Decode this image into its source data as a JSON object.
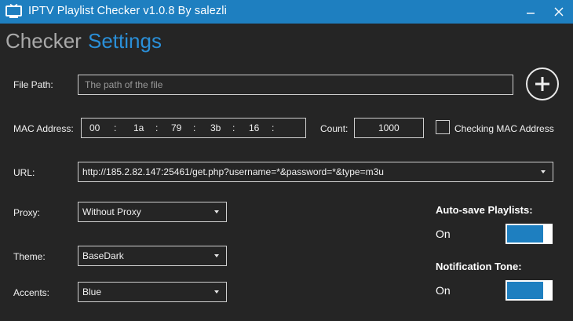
{
  "window": {
    "title": "IPTV Playlist Checker v1.0.8 By salezli",
    "accent_color": "#1e7fc0"
  },
  "tabs": [
    {
      "label": "Checker",
      "active": false
    },
    {
      "label": "Settings",
      "active": true
    }
  ],
  "file_path": {
    "label": "File Path:",
    "placeholder": "The path of the file",
    "add_icon": "plus-circle-icon"
  },
  "mac": {
    "label": "MAC Address:",
    "segments": [
      "00",
      "1a",
      "79",
      "3b",
      "16",
      ""
    ],
    "separator": ":"
  },
  "count": {
    "label": "Count:",
    "value": "1000"
  },
  "checking_mac": {
    "label": "Checking MAC Address",
    "checked": false
  },
  "url": {
    "label": "URL:",
    "value": "http://185.2.82.147:25461/get.php?username=*&password=*&type=m3u"
  },
  "proxy": {
    "label": "Proxy:",
    "value": "Without Proxy"
  },
  "theme": {
    "label": "Theme:",
    "value": "BaseDark"
  },
  "accents": {
    "label": "Accents:",
    "value": "Blue"
  },
  "auto_save": {
    "title": "Auto-save Playlists:",
    "state_label": "On",
    "on": true
  },
  "notification": {
    "title": "Notification Tone:",
    "state_label": "On",
    "on": true
  }
}
